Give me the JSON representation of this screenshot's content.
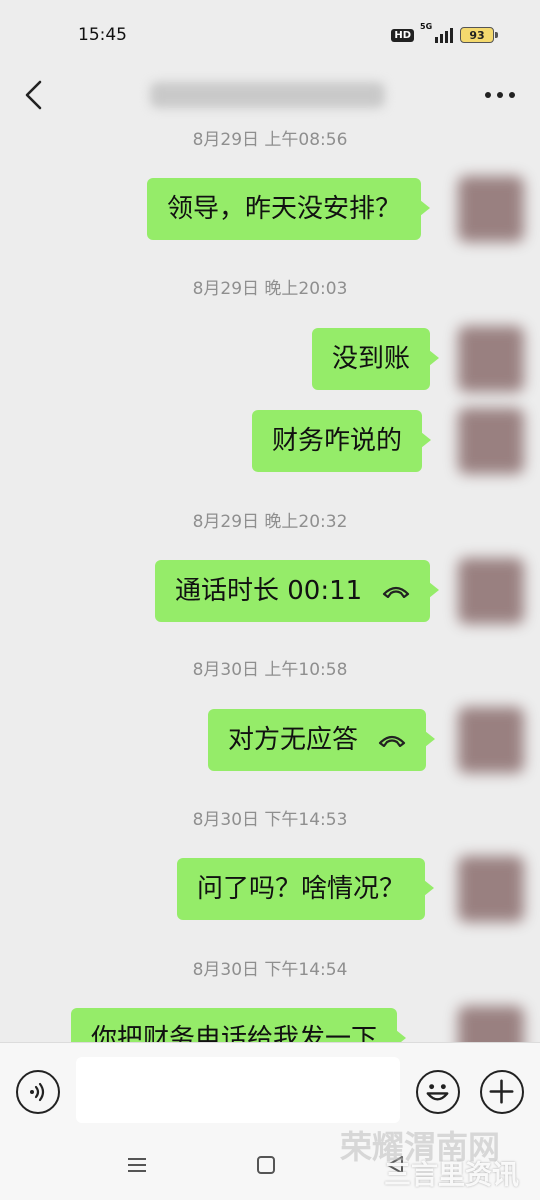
{
  "status_bar": {
    "time": "15:45",
    "hd": "HD",
    "network": "5G",
    "battery": "93"
  },
  "header": {
    "contact_name": "",
    "back_icon": "chevron-left-icon",
    "more_icon": "more-dots-icon"
  },
  "messages": [
    {
      "type": "time",
      "text": "8月29日 上午08:56"
    },
    {
      "type": "text",
      "text": "领导，昨天没安排？"
    },
    {
      "type": "time",
      "text": "8月29日 晚上20:03"
    },
    {
      "type": "text",
      "text": "没到账"
    },
    {
      "type": "text",
      "text": "财务咋说的"
    },
    {
      "type": "time",
      "text": "8月29日 晚上20:32"
    },
    {
      "type": "call",
      "text": "通话时长 00:11"
    },
    {
      "type": "time",
      "text": "8月30日 上午10:58"
    },
    {
      "type": "call",
      "text": "对方无应答"
    },
    {
      "type": "time",
      "text": "8月30日 下午14:53"
    },
    {
      "type": "text",
      "text": "问了吗？啥情况？"
    },
    {
      "type": "time",
      "text": "8月30日 下午14:54"
    },
    {
      "type": "text",
      "text": "你把财务电话给我发一下"
    }
  ],
  "input_bar": {
    "voice_icon": "voice-icon",
    "emoji_icon": "emoji-icon",
    "plus_icon": "plus-icon",
    "message_value": ""
  },
  "watermark": {
    "top": "荣耀渭南网",
    "bottom": "三言里资讯"
  },
  "colors": {
    "background": "#ededed",
    "bubble": "#95ec69",
    "timestamp": "#8f8f8f",
    "bar": "#f7f7f7"
  }
}
